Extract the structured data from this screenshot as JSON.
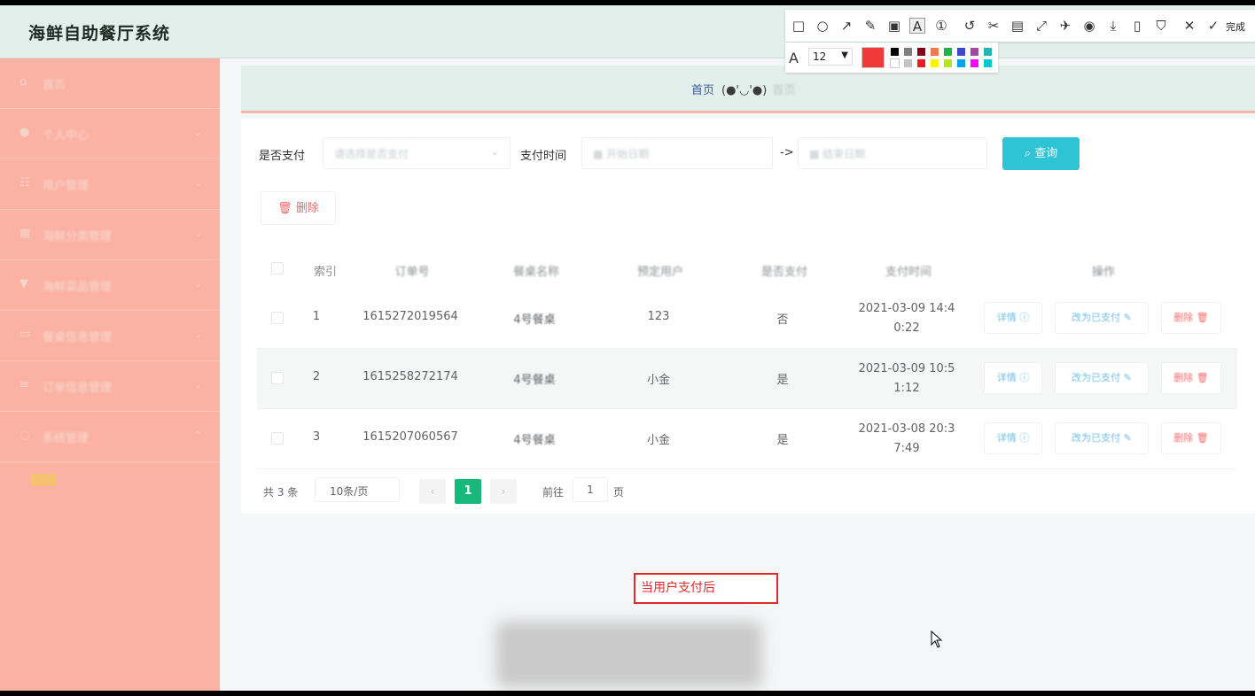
{
  "app": {
    "title": "海鲜自助餐厅系统"
  },
  "sidebar": {
    "items": [
      {
        "label": "首页",
        "icon": "home-icon",
        "glyph": "⌂"
      },
      {
        "label": "个人中心",
        "icon": "user-icon",
        "glyph": "●"
      },
      {
        "label": "用户管理",
        "icon": "users-icon",
        "glyph": "☷"
      },
      {
        "label": "海鲜分类管理",
        "icon": "category-icon",
        "glyph": "▦"
      },
      {
        "label": "海鲜菜品管理",
        "icon": "dish-icon",
        "glyph": "▼"
      },
      {
        "label": "餐桌信息管理",
        "icon": "table-icon",
        "glyph": "▭"
      },
      {
        "label": "订单信息管理",
        "icon": "list-icon",
        "glyph": "≡"
      },
      {
        "label": "系统管理",
        "icon": "settings-icon",
        "glyph": "◌"
      }
    ]
  },
  "breadcrumb": {
    "home": "首页",
    "face": "(●'◡'●)",
    "tail": "首页"
  },
  "filters": {
    "paid_label": "是否支付",
    "paid_placeholder": "请选择是否支付",
    "time_label": "支付时间",
    "start_placeholder": "开始日期",
    "range_sep": "->",
    "end_placeholder": "结束日期",
    "query_label": "查询"
  },
  "toolbar": {
    "delete_label": "删除"
  },
  "table": {
    "headers": [
      "索引",
      "订单号",
      "餐桌名称",
      "预定用户",
      "是否支付",
      "支付时间",
      "操作"
    ],
    "rows": [
      {
        "index": "1",
        "order_no": "1615272019564",
        "table_name": "4号餐桌",
        "user": "123",
        "paid": "否",
        "time_a": "2021-03-09 14:4",
        "time_b": "0:22"
      },
      {
        "index": "2",
        "order_no": "1615258272174",
        "table_name": "4号餐桌",
        "user": "小金",
        "paid": "是",
        "time_a": "2021-03-09 10:5",
        "time_b": "1:12"
      },
      {
        "index": "3",
        "order_no": "1615207060567",
        "table_name": "4号餐桌",
        "user": "小金",
        "paid": "是",
        "time_a": "2021-03-08 20:3",
        "time_b": "7:49"
      }
    ],
    "actions": {
      "detail": "详情",
      "mark_paid": "改为已支付",
      "delete": "删除"
    }
  },
  "pagination": {
    "total": "共 3 条",
    "page_size": "10条/页",
    "prev": "‹",
    "current": "1",
    "next": "›",
    "goto_label": "前往",
    "goto_value": "1",
    "goto_unit": "页"
  },
  "annotation": {
    "text": "当用户支付后"
  },
  "screenshot_tool": {
    "done_label": "完成",
    "font_size": "12",
    "active_color": "#f03a3a",
    "palette": [
      "#000000",
      "#7f7f7f",
      "#880015",
      "#e97e4c",
      "#22b14c",
      "#3f48cc",
      "#a349a4",
      "#1eb6bb",
      "#ffffff",
      "#c3c3c3",
      "#ed1c24",
      "#fff200",
      "#b5e61d",
      "#00a2e8",
      "#ff00ff",
      "#00c8d0"
    ]
  },
  "colors": {
    "sidebar": "#fbb2a2",
    "header": "#e3efea",
    "primary": "#2ec4d5",
    "page_active": "#17b97b",
    "danger": "#f26f6f"
  }
}
